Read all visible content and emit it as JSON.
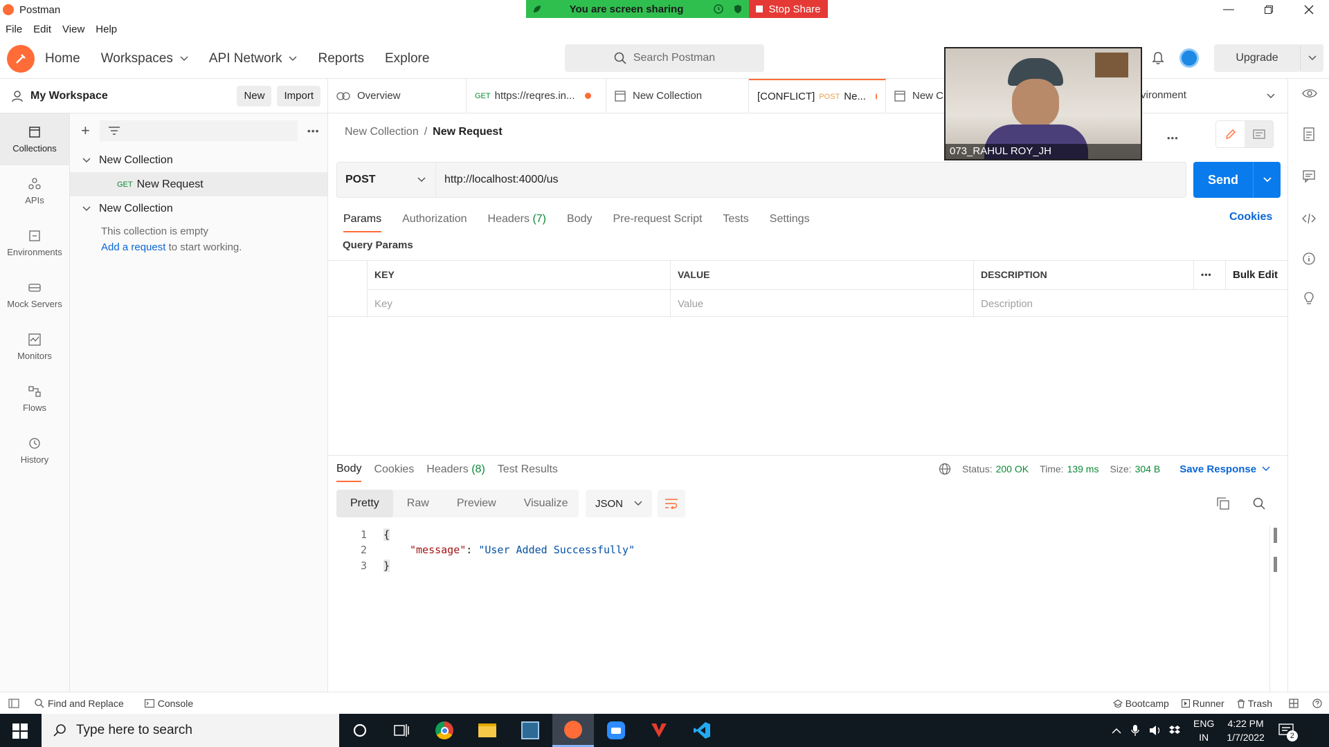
{
  "window": {
    "title": "Postman"
  },
  "menu": [
    "File",
    "Edit",
    "View",
    "Help"
  ],
  "share": {
    "status": "You are screen sharing",
    "stop": "Stop Share"
  },
  "nav": {
    "home": "Home",
    "workspaces": "Workspaces",
    "api_network": "API Network",
    "reports": "Reports",
    "explore": "Explore"
  },
  "search": {
    "placeholder": "Search Postman"
  },
  "upgrade": "Upgrade",
  "video": {
    "name": "073_RAHUL ROY_JH"
  },
  "workspace": {
    "name": "My Workspace",
    "new": "New",
    "import": "Import"
  },
  "rail": [
    {
      "label": "Collections"
    },
    {
      "label": "APIs"
    },
    {
      "label": "Environments"
    },
    {
      "label": "Mock Servers"
    },
    {
      "label": "Monitors"
    },
    {
      "label": "Flows"
    },
    {
      "label": "History"
    }
  ],
  "tree": {
    "collection1": "New Collection",
    "request_method": "GET",
    "request_name": "New Request",
    "collection2": "New Collection",
    "empty_text": "This collection is empty",
    "add_link": "Add a request",
    "add_rest": " to start working."
  },
  "tabs": {
    "overview": "Overview",
    "tab2_method": "GET",
    "tab2_label": "https://reqres.in...",
    "tab3_label": "New Collection",
    "tab4_prefix": "[CONFLICT]",
    "tab4_method": "POST",
    "tab4_label": "Ne...",
    "tab5_label": "New C",
    "env_label": "vironment"
  },
  "breadcrumb": {
    "parent": "New Collection",
    "sep": "/",
    "current": "New Request"
  },
  "request": {
    "method": "POST",
    "url": "http://localhost:4000/us",
    "send": "Send"
  },
  "req_tabs": {
    "params": "Params",
    "authorization": "Authorization",
    "headers": "Headers",
    "headers_count": "(7)",
    "body": "Body",
    "prerequest": "Pre-request Script",
    "tests": "Tests",
    "settings": "Settings",
    "cookies": "Cookies"
  },
  "query_params": {
    "title": "Query Params",
    "headers": {
      "key": "KEY",
      "value": "VALUE",
      "description": "DESCRIPTION",
      "bulk": "Bulk Edit"
    },
    "placeholders": {
      "key": "Key",
      "value": "Value",
      "description": "Description"
    }
  },
  "response": {
    "tabs": {
      "body": "Body",
      "cookies": "Cookies",
      "headers": "Headers",
      "headers_count": "(8)",
      "tests": "Test Results"
    },
    "status_label": "Status:",
    "status_value": "200 OK",
    "time_label": "Time:",
    "time_value": "139 ms",
    "size_label": "Size:",
    "size_value": "304 B",
    "save": "Save Response",
    "views": {
      "pretty": "Pretty",
      "raw": "Raw",
      "preview": "Preview",
      "visualize": "Visualize"
    },
    "format": "JSON",
    "lines": {
      "n1": "1",
      "n2": "2",
      "n3": "3",
      "open": "{",
      "key": "\"message\"",
      "colon": ": ",
      "value": "\"User Added Successfully\"",
      "close": "}"
    }
  },
  "statusbar": {
    "find": "Find and Replace",
    "console": "Console",
    "bootcamp": "Bootcamp",
    "runner": "Runner",
    "trash": "Trash"
  },
  "taskbar": {
    "search": "Type here to search",
    "lang1": "ENG",
    "lang2": "IN",
    "time": "4:22 PM",
    "date": "1/7/2022",
    "notif": "2"
  }
}
